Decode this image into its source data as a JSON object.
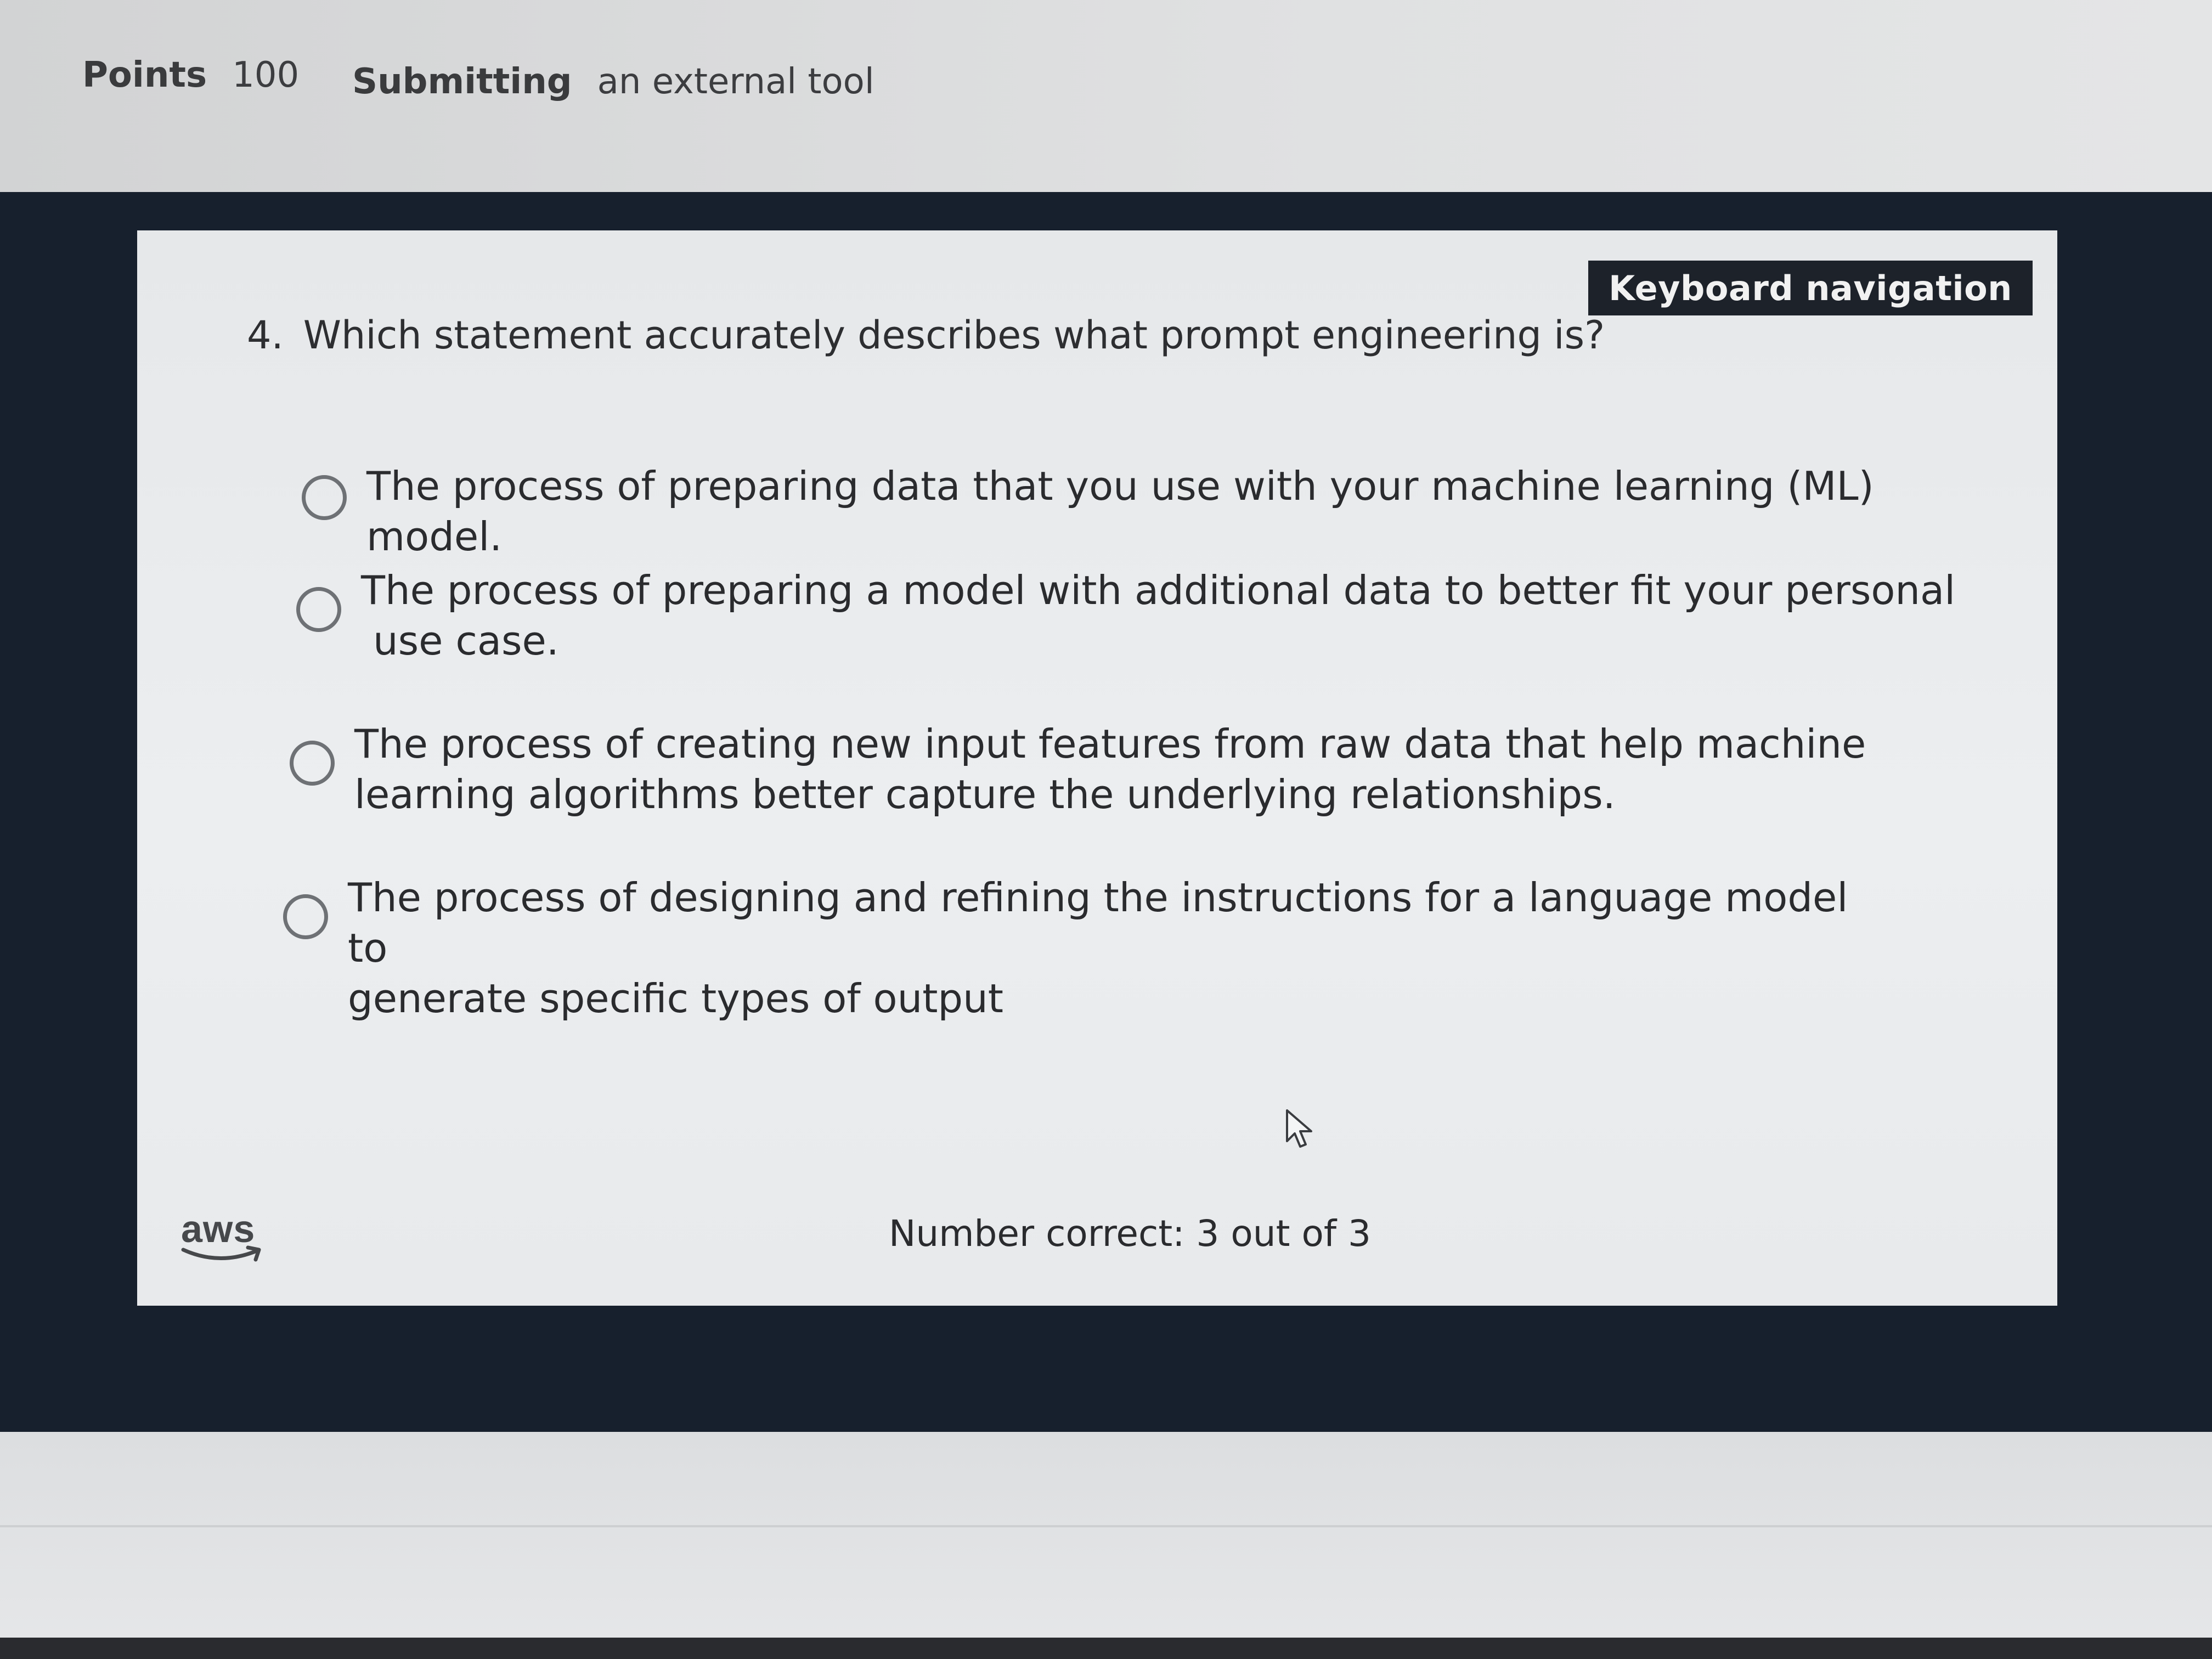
{
  "assignment_info": {
    "points_label": "Points",
    "points_value": "100",
    "submitting_label": "Submitting",
    "submitting_value": "an external tool"
  },
  "quiz": {
    "keyboard_navigation": "Keyboard navigation",
    "question_number": "4.",
    "question_text": "Which statement accurately describes what prompt engineering is?",
    "options": [
      {
        "line1": "The process of preparing data that you use with your machine learning (ML)  model.",
        "line2": ""
      },
      {
        "line1": "The process of preparing a model with additional data to better fit your personal",
        "line2": "use case."
      },
      {
        "line1": "The process of creating new input features from raw data that help machine",
        "line2": "learning algorithms better capture the underlying relationships."
      },
      {
        "line1": "The process of designing and refining the instructions for a language model to",
        "line2": "generate specific types of output"
      }
    ],
    "logo_text": "aws",
    "score_text": "Number correct: 3 out of 3"
  }
}
